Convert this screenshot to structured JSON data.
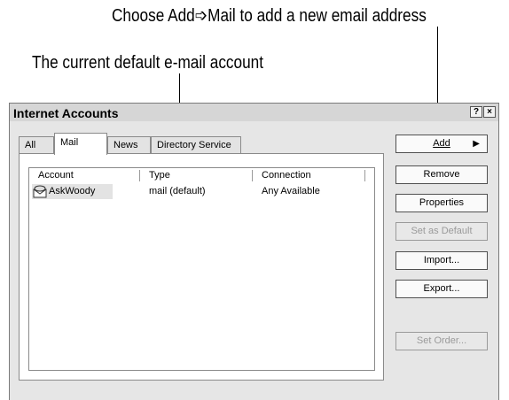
{
  "callouts": {
    "add_mail": "Choose Add➩Mail to add a new email address",
    "default_account": "The current default e-mail account"
  },
  "dialog": {
    "title": "Internet Accounts",
    "help_glyph": "?",
    "close_glyph": "×",
    "tabs": [
      {
        "label": "All",
        "active": false
      },
      {
        "label": "Mail",
        "active": true
      },
      {
        "label": "News",
        "active": false
      },
      {
        "label": "Directory Service",
        "active": false
      }
    ],
    "list": {
      "columns": [
        "Account",
        "Type",
        "Connection"
      ],
      "rows": [
        {
          "account": "AskWoody",
          "type": "mail (default)",
          "connection": "Any Available",
          "icon": "mail-account-icon",
          "selected": true
        }
      ]
    },
    "buttons": {
      "add": {
        "label": "Add",
        "arrow": "▶"
      },
      "remove": "Remove",
      "properties": "Properties",
      "set_default": "Set as Default",
      "import": "Import...",
      "export": "Export...",
      "set_order": "Set Order..."
    }
  }
}
